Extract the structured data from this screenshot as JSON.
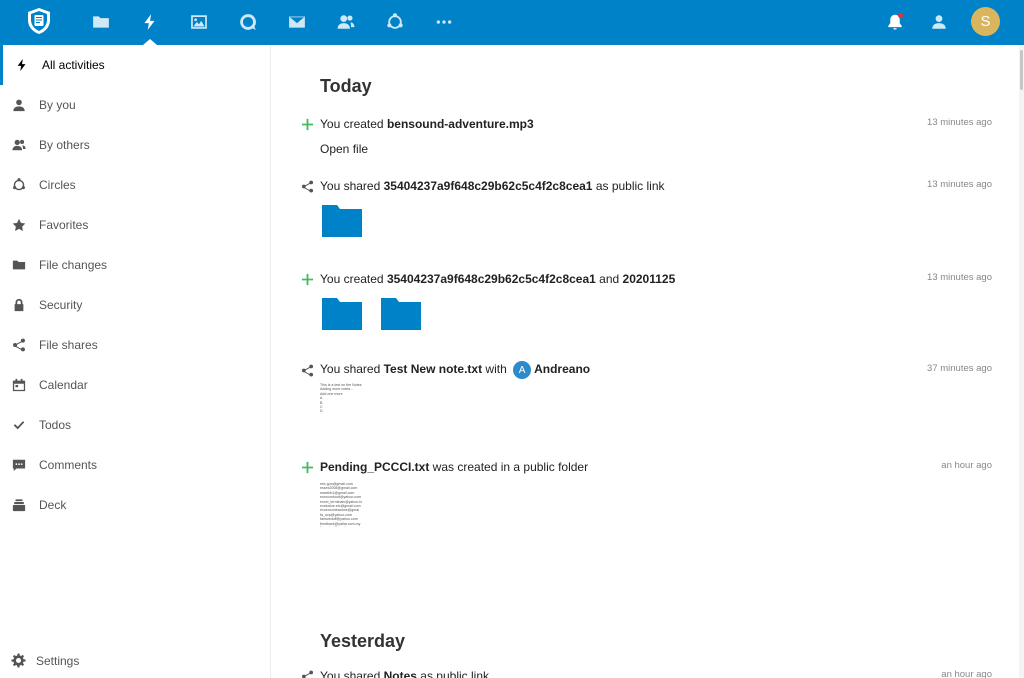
{
  "header": {
    "apps": [
      {
        "name": "files",
        "icon": "folder-icon"
      },
      {
        "name": "activity",
        "icon": "lightning-icon"
      },
      {
        "name": "photos",
        "icon": "image-icon"
      },
      {
        "name": "talk",
        "icon": "search-icon"
      },
      {
        "name": "mail",
        "icon": "envelope-icon"
      },
      {
        "name": "contacts",
        "icon": "users-icon"
      },
      {
        "name": "circles",
        "icon": "circles-icon"
      },
      {
        "name": "more",
        "icon": "more-icon"
      }
    ],
    "avatar_initial": "S",
    "colors": {
      "primary": "#0082c9",
      "avatar": "#d9b55e"
    }
  },
  "sidebar": {
    "items": [
      {
        "label": "All activities",
        "icon": "lightning-icon"
      },
      {
        "label": "By you",
        "icon": "user-icon"
      },
      {
        "label": "By others",
        "icon": "users-icon"
      },
      {
        "label": "Circles",
        "icon": "circles-icon"
      },
      {
        "label": "Favorites",
        "icon": "star-icon"
      },
      {
        "label": "File changes",
        "icon": "folder-icon"
      },
      {
        "label": "Security",
        "icon": "lock-icon"
      },
      {
        "label": "File shares",
        "icon": "share-icon"
      },
      {
        "label": "Calendar",
        "icon": "calendar-icon"
      },
      {
        "label": "Todos",
        "icon": "check-icon"
      },
      {
        "label": "Comments",
        "icon": "comment-icon"
      },
      {
        "label": "Deck",
        "icon": "deck-icon"
      }
    ],
    "settings_label": "Settings"
  },
  "main": {
    "today_title": "Today",
    "yesterday_title": "Yesterday",
    "activities": [
      {
        "prefix": "You created ",
        "bold": "bensound-adventure.mp3",
        "suffix": "",
        "time": "13 minutes ago",
        "action": "Open file"
      },
      {
        "prefix": "You shared ",
        "bold": "35404237a9f648c29b62c5c4f2c8cea1",
        "suffix": " as public link",
        "time": "13 minutes ago"
      },
      {
        "prefix": "You created ",
        "bold": "35404237a9f648c29b62c5c4f2c8cea1",
        "mid": " and ",
        "bold2": "20201125",
        "time": "13 minutes ago"
      },
      {
        "prefix": "You shared ",
        "bold": "Test New note.txt",
        "mid": " with ",
        "user_initial": "A",
        "user": "Andreano",
        "time": "37 minutes ago",
        "preview": "This is a test on the Notes\nAdding more notes...\nAdd one more\nA\nB\nC\nD"
      },
      {
        "bold": "Pending_PCCCI.txt",
        "suffix": " was created in a public folder",
        "time": "an hour ago",
        "preview": "eric.gon@gmail.com\nessex2008@gmail.com\neswebb1@gmail.com\neuroconfood@yahoo.com\nexcel_terminals@yahoo.in\nexclusive.etc@gmail.com\nexuencontractors@gmai\nfa_ocp@yahoo.com\nfamwedoff@yahoo.com\nfeedback@yaflar.com.my\nfiona.tan@gmail.com"
      },
      {
        "prefix": "You shared ",
        "bold": "Notes",
        "suffix": " as public link",
        "time": "an hour ago"
      }
    ]
  }
}
